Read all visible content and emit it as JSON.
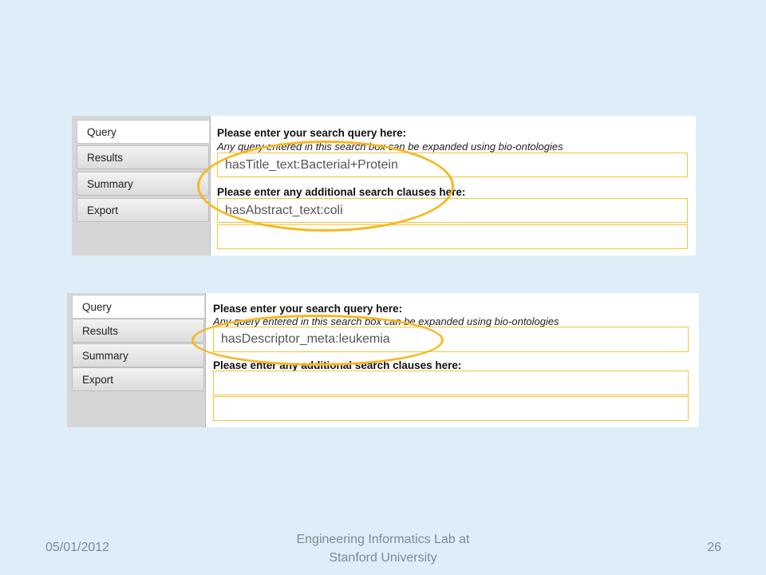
{
  "screens": [
    {
      "tabs": [
        "Query",
        "Results",
        "Summary",
        "Export"
      ],
      "query_heading": "Please enter your search query here:",
      "query_subtext": "Any query entered in this search box can be expanded using bio-ontologies",
      "query_value": "hasTitle_text:Bacterial+Protein",
      "clauses_heading": "Please enter any additional search clauses here:",
      "clause_values": [
        "hasAbstract_text:coli",
        ""
      ]
    },
    {
      "tabs": [
        "Query",
        "Results",
        "Summary",
        "Export"
      ],
      "query_heading": "Please enter your search query here:",
      "query_subtext": "Any query entered in this search box can be expanded using bio-ontologies",
      "query_value": "hasDescriptor_meta:leukemia",
      "clauses_heading": "Please enter any additional search clauses here:",
      "clause_values": [
        "",
        ""
      ]
    }
  ],
  "colors": {
    "highlight_oval": "#F6B81F",
    "field_border": "#F2C53C",
    "slide_bg": "#DDEEF9"
  },
  "footer": {
    "date": "05/01/2012",
    "center": "Engineering Informatics Lab at\nStanford University",
    "page": "26"
  }
}
